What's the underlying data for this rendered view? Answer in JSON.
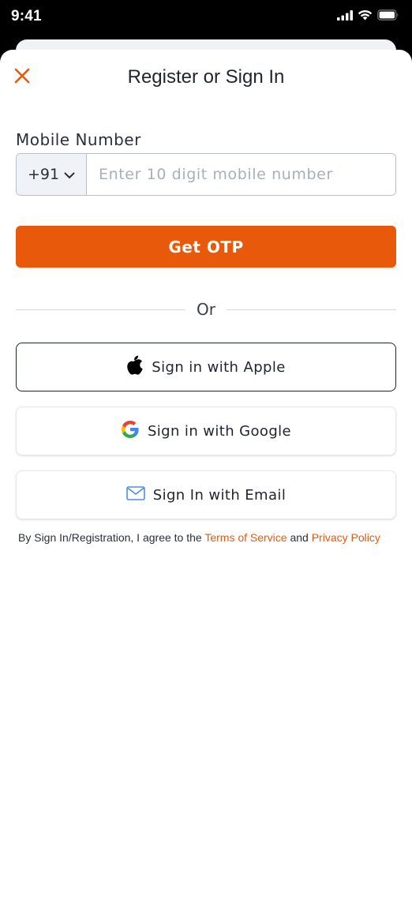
{
  "status_bar": {
    "time": "9:41",
    "icons": [
      "cellular-signal-icon",
      "wifi-icon",
      "battery-icon"
    ]
  },
  "sheet": {
    "title": "Register or Sign In",
    "close_icon": "close-icon"
  },
  "mobile": {
    "label": "Mobile Number",
    "country_code": "+91",
    "placeholder": "Enter 10 digit mobile number",
    "value": ""
  },
  "otp_button": {
    "label": "Get OTP"
  },
  "divider": {
    "text": "Or"
  },
  "social": {
    "apple_label": "Sign in with Apple",
    "google_label": "Sign in with Google",
    "email_label": "Sign In with Email"
  },
  "terms": {
    "prefix": "By Sign In/Registration, I agree to the ",
    "terms_link": "Terms of Service",
    "and": " and ",
    "privacy_link": "Privacy Policy"
  },
  "colors": {
    "accent": "#e8590c",
    "text": "#1f2430",
    "border": "#b7c0cc"
  }
}
